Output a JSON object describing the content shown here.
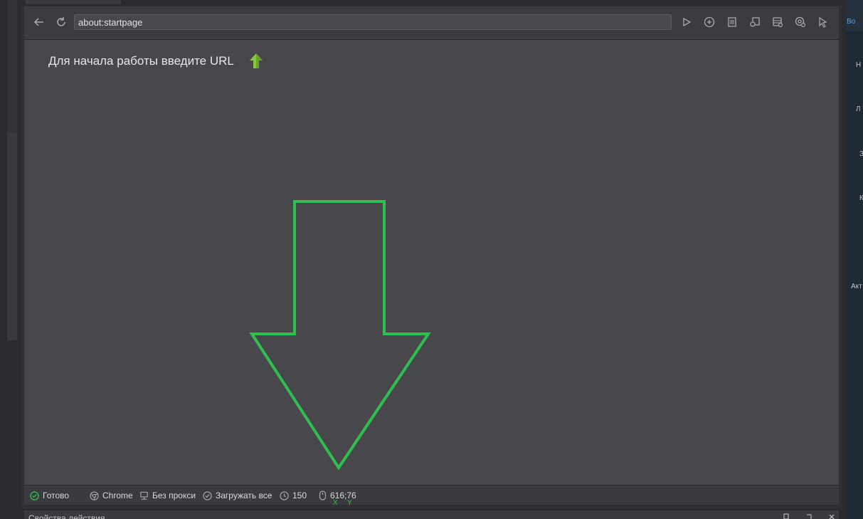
{
  "toolbar": {
    "url_value": "about:startpage"
  },
  "viewport": {
    "start_message": "Для начала работы введите URL"
  },
  "statusbar": {
    "status": "Готово",
    "browser": "Chrome",
    "proxy": "Без прокси",
    "load_mode": "Загружать все",
    "timeout": "150",
    "coords": "616;76",
    "axis_x": "X",
    "axis_y": "Y"
  },
  "bottom_panel": {
    "title": "Свойства действия"
  },
  "right_panel": {
    "items": [
      "Во",
      "Н",
      "Л",
      "З",
      "К",
      "Акт"
    ]
  },
  "colors": {
    "accent_green": "#2fbf4f",
    "url_arrow": "#8cc63f",
    "viewport_bg": "#47474c"
  }
}
